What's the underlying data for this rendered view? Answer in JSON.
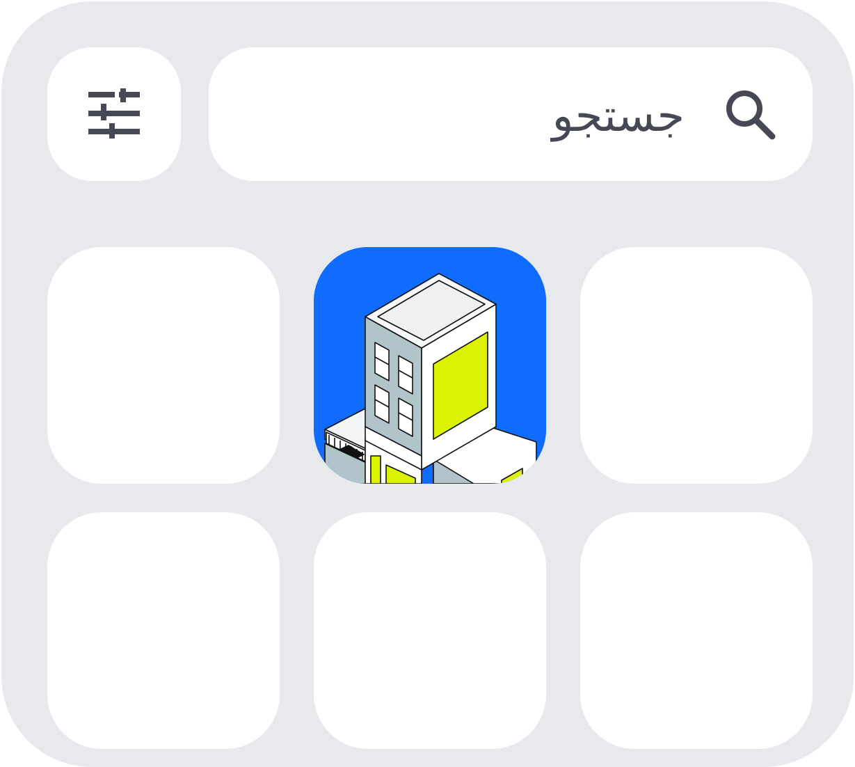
{
  "search": {
    "placeholder": "جستجو",
    "icon": "search-icon"
  },
  "filter": {
    "icon": "sliders-icon"
  },
  "grid": {
    "featured_app": {
      "icon": "building-app-icon",
      "row": 1,
      "column": 2
    }
  },
  "colors": {
    "background": "#e8e9ec",
    "tile": "#ffffff",
    "icon": "#464855",
    "app_accent": "#0f6cfe",
    "highlight": "#dbf200",
    "building_wall": "#b0c4ca"
  }
}
